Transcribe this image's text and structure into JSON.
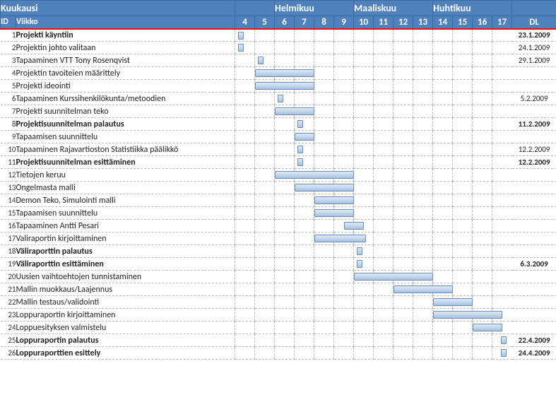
{
  "header": {
    "kuukausi": "Kuukausi",
    "viikko": "Viikko",
    "dl": "DL",
    "months": [
      "Helmikuu",
      "Maaliskuu",
      "Huhtikuu"
    ],
    "weeks": [
      4,
      5,
      6,
      7,
      8,
      9,
      10,
      11,
      12,
      13,
      14,
      15,
      16,
      17
    ]
  },
  "col_widths": {
    "id": 22,
    "name": 310,
    "week": 28,
    "dl": 63
  },
  "tasks": [
    {
      "id": 1,
      "name": "Projekti käyntiin",
      "bold": true,
      "start": 4,
      "end": 4.3,
      "small": true,
      "dl": "23.1.2009"
    },
    {
      "id": 2,
      "name": "Projektin johto valitaan",
      "bold": false,
      "start": 4,
      "end": 4.3,
      "small": true,
      "dl": "24.1.2009"
    },
    {
      "id": 3,
      "name": "Tapaaminen VTT Tony Rosenqvist",
      "bold": false,
      "start": 5,
      "end": 5.3,
      "small": true,
      "dl": "29.1.2009"
    },
    {
      "id": 4,
      "name": "Projektin tavoiteien määrittely",
      "bold": false,
      "start": 5,
      "end": 8,
      "dl": ""
    },
    {
      "id": 5,
      "name": "Projekti ideointi",
      "bold": false,
      "start": 5,
      "end": 8,
      "dl": ""
    },
    {
      "id": 6,
      "name": "Tapaaminen Kurssihenkilökunta/metoodien",
      "bold": false,
      "start": 6,
      "end": 6.3,
      "small": true,
      "dl": "5.2.2009"
    },
    {
      "id": 7,
      "name": "Projekti suunnitelman teko",
      "bold": false,
      "start": 6,
      "end": 8,
      "dl": ""
    },
    {
      "id": 8,
      "name": "Projektisuunnitelman palautus",
      "bold": true,
      "start": 7,
      "end": 7.3,
      "small": true,
      "dl": "11.2.2009"
    },
    {
      "id": 9,
      "name": "Tapaamisen suunnittelu",
      "bold": false,
      "start": 7,
      "end": 8,
      "dl": ""
    },
    {
      "id": 10,
      "name": "Tapaaminen Rajavartioston Statistiikka päälikkö",
      "bold": false,
      "start": 7,
      "end": 7.3,
      "small": true,
      "dl": "12.2.2009"
    },
    {
      "id": 11,
      "name": "Projektisuunnitelman esittäminen",
      "bold": true,
      "start": 7,
      "end": 7.3,
      "small": true,
      "dl": "12.2.2009"
    },
    {
      "id": 12,
      "name": "Tietojen keruu",
      "bold": false,
      "start": 6,
      "end": 10,
      "dl": ""
    },
    {
      "id": 13,
      "name": "Ongelmasta malli",
      "bold": false,
      "start": 7,
      "end": 10,
      "dl": ""
    },
    {
      "id": 14,
      "name": "Demon Teko, Simulointi malli",
      "bold": false,
      "start": 8,
      "end": 10,
      "dl": ""
    },
    {
      "id": 15,
      "name": "Tapaamisen suunnittelu",
      "bold": false,
      "start": 8,
      "end": 10,
      "dl": ""
    },
    {
      "id": 16,
      "name": "Tapaaminen Antti Pesari",
      "bold": false,
      "start": 9.5,
      "end": 10.5,
      "dl": ""
    },
    {
      "id": 17,
      "name": "Valiraportin kirjoittaminen",
      "bold": false,
      "start": 8,
      "end": 10.6,
      "dl": ""
    },
    {
      "id": 18,
      "name": "Väliraporttin palautus",
      "bold": true,
      "start": 10,
      "end": 10.3,
      "small": true,
      "dl": ""
    },
    {
      "id": 19,
      "name": "Väliraporttin esittäminen",
      "bold": true,
      "start": 10,
      "end": 10.3,
      "small": true,
      "dl": "6.3.2009"
    },
    {
      "id": 20,
      "name": "Uusien vaihtoehtojen tunnistaminen",
      "bold": false,
      "start": 10,
      "end": 14,
      "dl": ""
    },
    {
      "id": 21,
      "name": "Mallin muokkaus/Laajennus",
      "bold": false,
      "start": 12,
      "end": 15,
      "dl": ""
    },
    {
      "id": 22,
      "name": "Mallin testaus/validointi",
      "bold": false,
      "start": 14,
      "end": 16,
      "dl": ""
    },
    {
      "id": 23,
      "name": "Loppuraportin kirjoittaminen",
      "bold": false,
      "start": 14,
      "end": 17.5,
      "dl": ""
    },
    {
      "id": 24,
      "name": "Loppuesityksen valmistelu",
      "bold": false,
      "start": 16,
      "end": 17.5,
      "dl": ""
    },
    {
      "id": 25,
      "name": "Loppuraportin palautus",
      "bold": true,
      "start": 17.3,
      "end": 17.6,
      "small": true,
      "dl": "22.4.2009"
    },
    {
      "id": 26,
      "name": "Loppuraporttien esittely",
      "bold": true,
      "start": 17.3,
      "end": 17.6,
      "small": true,
      "dl": "24.4.2009"
    }
  ],
  "chart_data": {
    "type": "bar",
    "title": "",
    "xlabel": "Viikko",
    "ylabel": "",
    "x_range": [
      4,
      17
    ],
    "series": [
      {
        "name": "Projekti käyntiin",
        "start": 4,
        "end": 4.3,
        "dl": "23.1.2009"
      },
      {
        "name": "Projektin johto valitaan",
        "start": 4,
        "end": 4.3,
        "dl": "24.1.2009"
      },
      {
        "name": "Tapaaminen VTT Tony Rosenqvist",
        "start": 5,
        "end": 5.3,
        "dl": "29.1.2009"
      },
      {
        "name": "Projektin tavoiteien määrittely",
        "start": 5,
        "end": 8
      },
      {
        "name": "Projekti ideointi",
        "start": 5,
        "end": 8
      },
      {
        "name": "Tapaaminen Kurssihenkilökunta/metoodien",
        "start": 6,
        "end": 6.3,
        "dl": "5.2.2009"
      },
      {
        "name": "Projekti suunnitelman teko",
        "start": 6,
        "end": 8
      },
      {
        "name": "Projektisuunnitelman palautus",
        "start": 7,
        "end": 7.3,
        "dl": "11.2.2009"
      },
      {
        "name": "Tapaamisen suunnittelu",
        "start": 7,
        "end": 8
      },
      {
        "name": "Tapaaminen Rajavartioston Statistiikka päälikkö",
        "start": 7,
        "end": 7.3,
        "dl": "12.2.2009"
      },
      {
        "name": "Projektisuunnitelman esittäminen",
        "start": 7,
        "end": 7.3,
        "dl": "12.2.2009"
      },
      {
        "name": "Tietojen keruu",
        "start": 6,
        "end": 10
      },
      {
        "name": "Ongelmasta malli",
        "start": 7,
        "end": 10
      },
      {
        "name": "Demon Teko, Simulointi malli",
        "start": 8,
        "end": 10
      },
      {
        "name": "Tapaamisen suunnittelu",
        "start": 8,
        "end": 10
      },
      {
        "name": "Tapaaminen Antti Pesari",
        "start": 9.5,
        "end": 10.5
      },
      {
        "name": "Valiraportin kirjoittaminen",
        "start": 8,
        "end": 10.6
      },
      {
        "name": "Väliraporttin palautus",
        "start": 10,
        "end": 10.3
      },
      {
        "name": "Väliraporttin esittäminen",
        "start": 10,
        "end": 10.3,
        "dl": "6.3.2009"
      },
      {
        "name": "Uusien vaihtoehtojen tunnistaminen",
        "start": 10,
        "end": 14
      },
      {
        "name": "Mallin muokkaus/Laajennus",
        "start": 12,
        "end": 15
      },
      {
        "name": "Mallin testaus/validointi",
        "start": 14,
        "end": 16
      },
      {
        "name": "Loppuraportin kirjoittaminen",
        "start": 14,
        "end": 17.5
      },
      {
        "name": "Loppuesityksen valmistelu",
        "start": 16,
        "end": 17.5
      },
      {
        "name": "Loppuraportin palautus",
        "start": 17.3,
        "end": 17.6,
        "dl": "22.4.2009"
      },
      {
        "name": "Loppuraporttien esittely",
        "start": 17.3,
        "end": 17.6,
        "dl": "24.4.2009"
      }
    ]
  }
}
